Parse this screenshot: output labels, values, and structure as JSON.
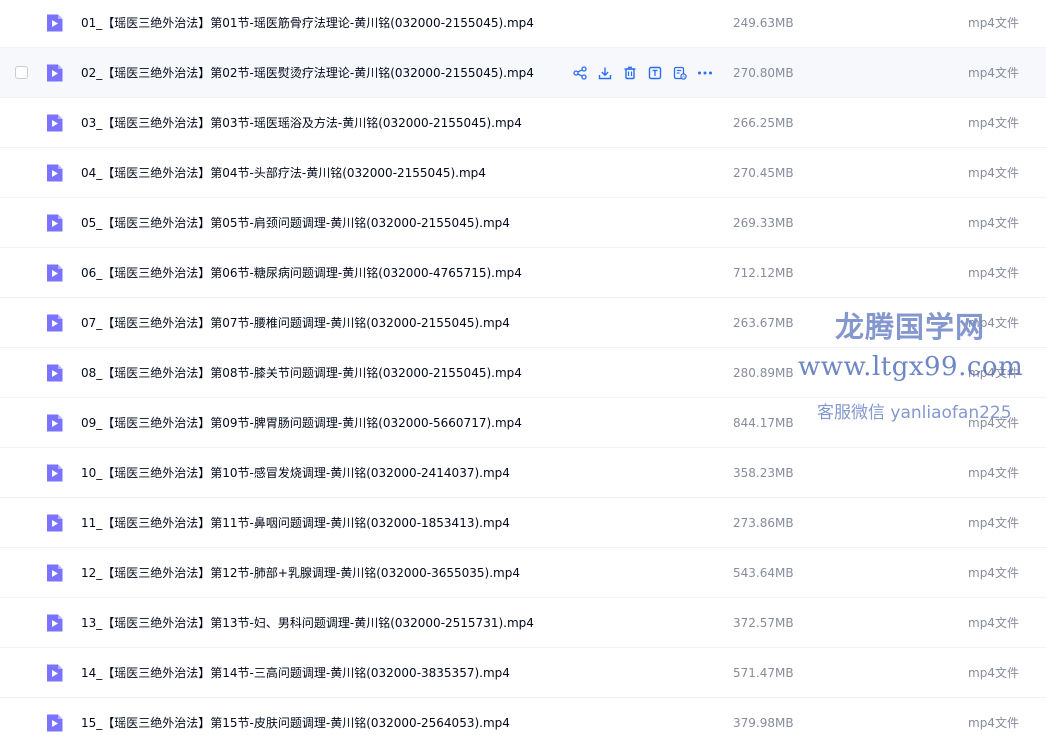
{
  "files": [
    {
      "name": "01_【瑶医三绝外治法】第01节-瑶医筋骨疗法理论-黄川铭(032000-2155045).mp4",
      "size": "249.63MB",
      "type": "mp4文件"
    },
    {
      "name": "02_【瑶医三绝外治法】第02节-瑶医熨烫疗法理论-黄川铭(032000-2155045).mp4",
      "size": "270.80MB",
      "type": "mp4文件"
    },
    {
      "name": "03_【瑶医三绝外治法】第03节-瑶医瑶浴及方法-黄川铭(032000-2155045).mp4",
      "size": "266.25MB",
      "type": "mp4文件"
    },
    {
      "name": "04_【瑶医三绝外治法】第04节-头部疗法-黄川铭(032000-2155045).mp4",
      "size": "270.45MB",
      "type": "mp4文件"
    },
    {
      "name": "05_【瑶医三绝外治法】第05节-肩颈问题调理-黄川铭(032000-2155045).mp4",
      "size": "269.33MB",
      "type": "mp4文件"
    },
    {
      "name": "06_【瑶医三绝外治法】第06节-糖尿病问题调理-黄川铭(032000-4765715).mp4",
      "size": "712.12MB",
      "type": "mp4文件"
    },
    {
      "name": "07_【瑶医三绝外治法】第07节-腰椎问题调理-黄川铭(032000-2155045).mp4",
      "size": "263.67MB",
      "type": "mp4文件"
    },
    {
      "name": "08_【瑶医三绝外治法】第08节-膝关节问题调理-黄川铭(032000-2155045).mp4",
      "size": "280.89MB",
      "type": "mp4文件"
    },
    {
      "name": "09_【瑶医三绝外治法】第09节-脾胃肠问题调理-黄川铭(032000-5660717).mp4",
      "size": "844.17MB",
      "type": "mp4文件"
    },
    {
      "name": "10_【瑶医三绝外治法】第10节-感冒发烧调理-黄川铭(032000-2414037).mp4",
      "size": "358.23MB",
      "type": "mp4文件"
    },
    {
      "name": "11_【瑶医三绝外治法】第11节-鼻咽问题调理-黄川铭(032000-1853413).mp4",
      "size": "273.86MB",
      "type": "mp4文件"
    },
    {
      "name": "12_【瑶医三绝外治法】第12节-肺部+乳腺调理-黄川铭(032000-3655035).mp4",
      "size": "543.64MB",
      "type": "mp4文件"
    },
    {
      "name": "13_【瑶医三绝外治法】第13节-妇、男科问题调理-黄川铭(032000-2515731).mp4",
      "size": "372.57MB",
      "type": "mp4文件"
    },
    {
      "name": "14_【瑶医三绝外治法】第14节-三高问题调理-黄川铭(032000-3835357).mp4",
      "size": "571.47MB",
      "type": "mp4文件"
    },
    {
      "name": "15_【瑶医三绝外治法】第15节-皮肤问题调理-黄川铭(032000-2564053).mp4",
      "size": "379.98MB",
      "type": "mp4文件"
    }
  ],
  "hovered_row": 1,
  "row_actions": [
    {
      "name": "share-icon",
      "color": "#2b6cf6"
    },
    {
      "name": "download-icon",
      "color": "#2b6cf6"
    },
    {
      "name": "delete-icon",
      "color": "#2b6cf6"
    },
    {
      "name": "extract-text-icon",
      "color": "#2b6cf6"
    },
    {
      "name": "ai-assistant-icon",
      "color": "#2b6cf6"
    },
    {
      "name": "more-icon",
      "color": "#2b6cf6"
    }
  ],
  "file_icon_color": "#7a73ff",
  "watermark": {
    "title": "龙腾国学网",
    "url": "www.ltgx99.com",
    "contact": "客服微信 yanliaofan225"
  }
}
